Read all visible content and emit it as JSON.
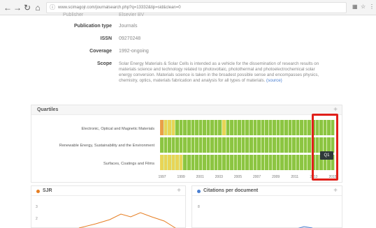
{
  "browser": {
    "url": "www.scimagojr.com/journalsearch.php?q=13332&tip=sid&clean=0",
    "icons": [
      "back-icon",
      "forward-icon",
      "reload-icon",
      "home-icon",
      "info-icon",
      "extensions-icon",
      "star-icon",
      "menu-icon"
    ]
  },
  "info": {
    "top_cut_label": "Publisher",
    "top_cut_value": "Elsevier BV",
    "rows": [
      {
        "label": "Publication type",
        "value": "Journals"
      },
      {
        "label": "ISSN",
        "value": "09270248"
      },
      {
        "label": "Coverage",
        "value": "1992-ongoing"
      }
    ],
    "scope_label": "Scope",
    "scope_text": "Solar Energy Materials & Solar Cells is intended as a vehicle for the dissemination of research results on materials science and technology related to photovoltaic, photothermal and photoelectrochemical solar energy conversion. Materials science is taken in the broadest possible sense and encompasses physics, chemistry, optics, materials fabrication and analysis for all types of materials.",
    "scope_source": "(source)"
  },
  "quartiles": {
    "title": "Quartiles",
    "plus": "+",
    "colors": {
      "Q1": "#8cc542",
      "Q2": "#e8d556",
      "Q3": "#e9a048",
      "Q4": "#dd5a4e"
    },
    "rows": [
      {
        "label": "Electronic, Optical and Magnetic Materials",
        "cells": [
          "Q3",
          "Q2",
          "Q2",
          "Q2",
          "Q1",
          "Q1",
          "Q1",
          "Q1",
          "Q1",
          "Q1",
          "Q1",
          "Q1",
          "Q1",
          "Q1",
          "Q1",
          "Q1",
          "Q2",
          "Q1",
          "Q1",
          "Q1",
          "Q1",
          "Q1",
          "Q1",
          "Q1",
          "Q1",
          "Q1",
          "Q1",
          "Q1",
          "Q1",
          "Q1",
          "Q1",
          "Q1",
          "Q1",
          "Q1",
          "Q1",
          "Q1",
          "Q1",
          "Q1",
          "Q1",
          "Q1",
          "Q1",
          "Q1",
          "Q1",
          "Q1",
          "Q1"
        ]
      },
      {
        "label": "Renewable Energy, Sustainability and the Environment",
        "cells": [
          "Q1",
          "Q1",
          "Q1",
          "Q1",
          "Q1",
          "Q1",
          "Q1",
          "Q1",
          "Q1",
          "Q1",
          "Q1",
          "Q1",
          "Q1",
          "Q1",
          "Q1",
          "Q1",
          "Q1",
          "Q1",
          "Q1",
          "Q1",
          "Q1",
          "Q1",
          "Q1",
          "Q1",
          "Q1",
          "Q1",
          "Q1",
          "Q1",
          "Q1",
          "Q1",
          "Q1",
          "Q1",
          "Q1",
          "Q1",
          "Q1",
          "Q1",
          "Q1",
          "Q1",
          "Q1",
          "Q1",
          "Q1",
          "Q1",
          "Q1",
          "Q1",
          "Q1"
        ]
      },
      {
        "label": "Surfaces, Coatings and Films",
        "cells": [
          "Q2",
          "Q2",
          "Q2",
          "Q2",
          "Q2",
          "Q2",
          "Q1",
          "Q1",
          "Q1",
          "Q1",
          "Q1",
          "Q1",
          "Q1",
          "Q1",
          "Q1",
          "Q1",
          "Q1",
          "Q1",
          "Q1",
          "Q1",
          "Q1",
          "Q1",
          "Q1",
          "Q1",
          "Q1",
          "Q1",
          "Q1",
          "Q1",
          "Q1",
          "Q1",
          "Q1",
          "Q1",
          "Q1",
          "Q1",
          "Q1",
          "Q1",
          "Q1",
          "Q1",
          "Q1",
          "Q1",
          "Q1",
          "Q1",
          "Q1",
          "Q1",
          "Q1"
        ]
      }
    ],
    "years": [
      "1997",
      "1999",
      "2001",
      "2003",
      "2005",
      "2007",
      "2009",
      "2011",
      "2013",
      "2015"
    ],
    "tooltip": "Q1"
  },
  "sjr": {
    "title": "SJR",
    "plus": "+",
    "ticks": [
      "3",
      "2"
    ]
  },
  "citations": {
    "title": "Citations per document",
    "plus": "+",
    "ticks": [
      "8"
    ]
  }
}
